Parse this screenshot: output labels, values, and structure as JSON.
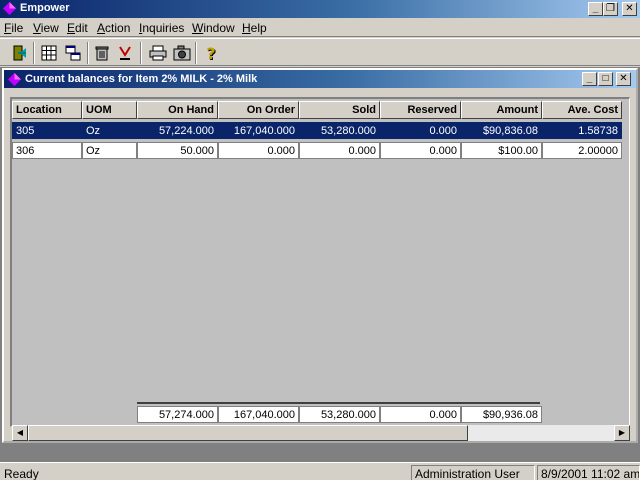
{
  "app": {
    "title": "Empower"
  },
  "menu": [
    {
      "label": "File",
      "key": "F",
      "rest": "ile"
    },
    {
      "label": "View",
      "key": "V",
      "rest": "iew"
    },
    {
      "label": "Edit",
      "key": "E",
      "rest": "dit"
    },
    {
      "label": "Action",
      "key": "A",
      "rest": "ction"
    },
    {
      "label": "Inquiries",
      "key": "I",
      "rest": "nquiries"
    },
    {
      "label": "Window",
      "key": "W",
      "rest": "indow"
    },
    {
      "label": "Help",
      "key": "H",
      "rest": "elp"
    }
  ],
  "toolbar": {
    "icons": [
      "exit-door-icon",
      "grid-view-icon",
      "cascade-windows-icon",
      "trash-icon",
      "sort-icon",
      "print-icon",
      "camera-icon",
      "help-icon"
    ]
  },
  "child_window": {
    "title": "Current balances for Item 2% MILK - 2% Milk"
  },
  "table": {
    "columns": [
      "Location",
      "UOM",
      "On Hand",
      "On Order",
      "Sold",
      "Reserved",
      "Amount",
      "Ave. Cost"
    ],
    "rows": [
      {
        "selected": true,
        "cells": [
          "305",
          "Oz",
          "57,224.000",
          "167,040.000",
          "53,280.000",
          "0.000",
          "$90,836.08",
          "1.58738"
        ]
      },
      {
        "selected": false,
        "cells": [
          "306",
          "Oz",
          "50.000",
          "0.000",
          "0.000",
          "0.000",
          "$100.00",
          "2.00000"
        ]
      }
    ],
    "totals": [
      "57,274.000",
      "167,040.000",
      "53,280.000",
      "0.000",
      "$90,936.08"
    ]
  },
  "status": {
    "left": "Ready",
    "user": "Administration User",
    "datetime": "8/9/2001 11:02 am"
  },
  "colors": {
    "titlebar_start": "#0a246a",
    "titlebar_end": "#a6caf0",
    "selection": "#0a246a"
  }
}
